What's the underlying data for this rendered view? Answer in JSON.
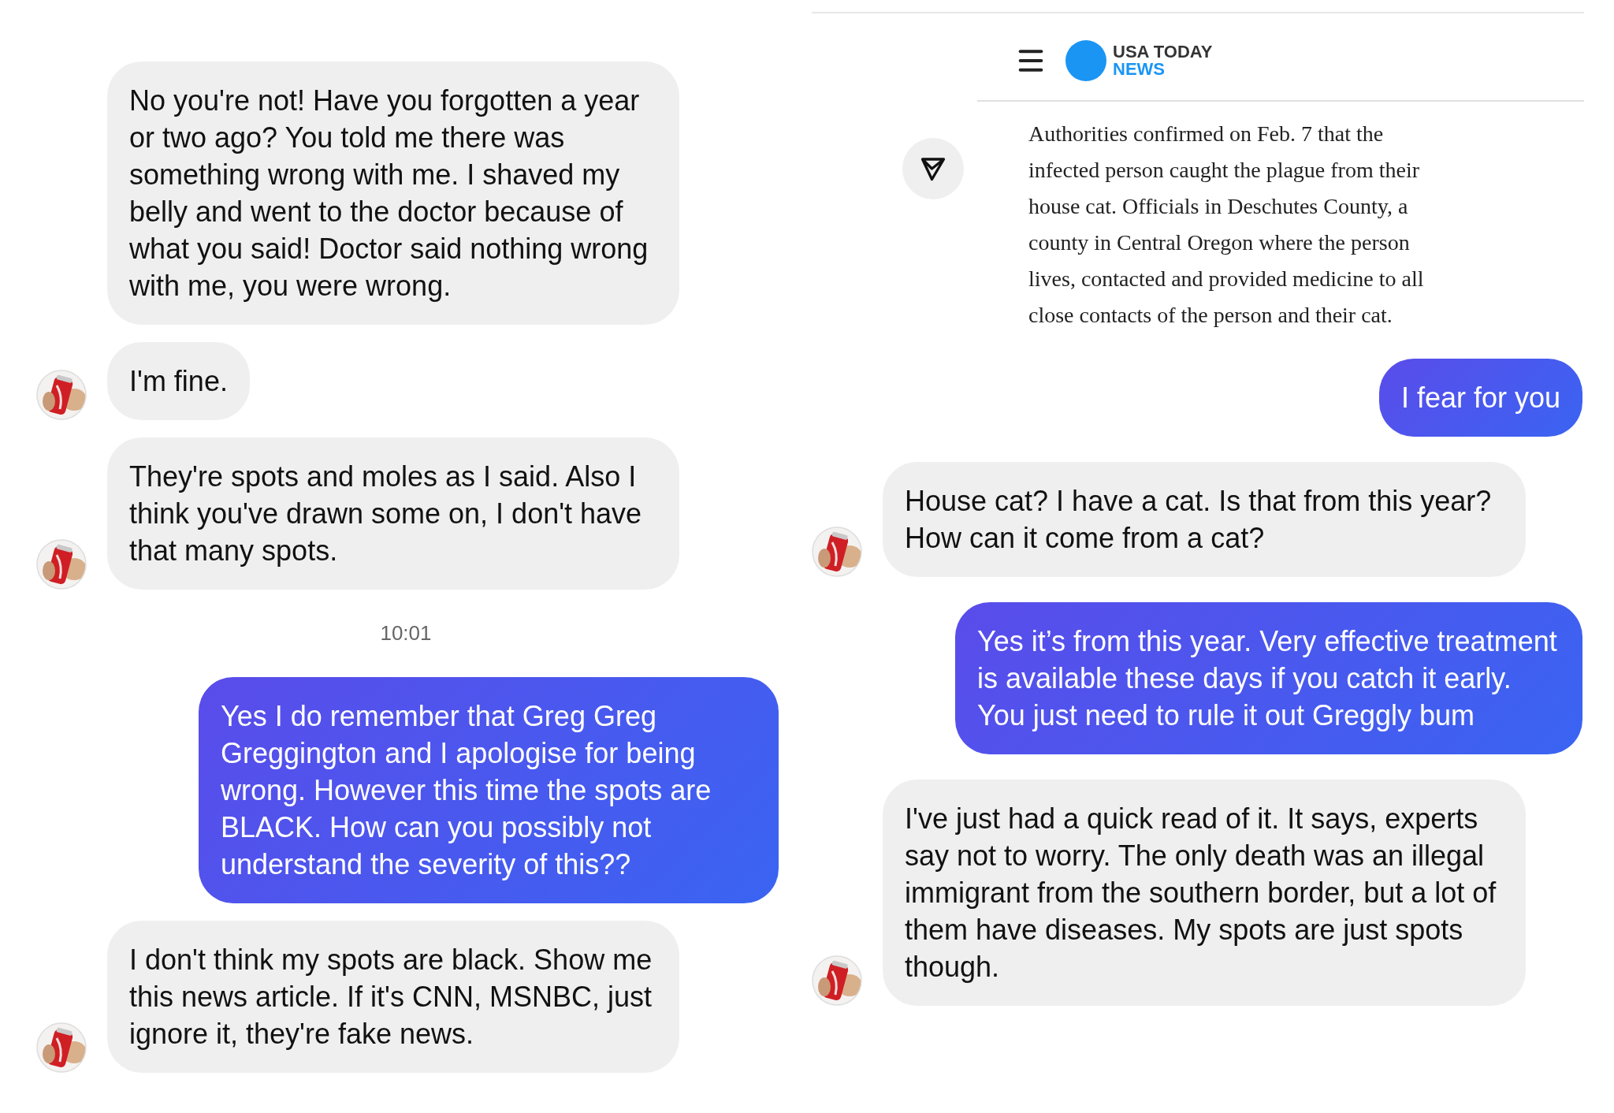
{
  "left_thread": [
    {
      "kind": "received",
      "avatar": false,
      "text": "No you're not! Have you forgotten a year or two ago? You told me there was something wrong with me. I shaved my belly and went to the doctor because of what you said! Doctor said nothing wrong with me, you were wrong."
    },
    {
      "kind": "received",
      "avatar": true,
      "text": "I'm fine."
    },
    {
      "kind": "received",
      "avatar": true,
      "text": "They're spots and moles as I said. Also I think you've drawn some on, I don't have that many spots."
    },
    {
      "kind": "time",
      "text": "10:01"
    },
    {
      "kind": "sent",
      "text": "Yes I do remember that Greg Greg Greggington and I apologise for being wrong. However this time the spots are BLACK. How can you possibly not understand the severity of this??"
    },
    {
      "kind": "received",
      "avatar": true,
      "text": "I don't think my spots are black. Show me this news article. If it's CNN, MSNBC, just ignore it, they're fake news."
    }
  ],
  "right_thread": [
    {
      "kind": "article",
      "logo_top": "USA TODAY",
      "logo_bottom": "NEWS",
      "text": "Authorities confirmed on Feb. 7 that the infected person caught the plague from their house cat. Officials in Deschutes County, a county in Central Oregon where the person lives, contacted and provided medicine to all close contacts of the person and their cat."
    },
    {
      "kind": "sent",
      "text": "I fear for you"
    },
    {
      "kind": "received",
      "avatar": true,
      "text": "House cat? I have a cat. Is that from this year? How can it come from a cat?"
    },
    {
      "kind": "sent",
      "text": "Yes it’s from this year. Very effective treatment is available these days if you catch it early. You just need to rule it out Greggly bum"
    },
    {
      "kind": "received",
      "avatar": true,
      "text": "I've just had a quick read of it. It says, experts say not to worry. The only death was an illegal immigrant from the southern border, but a lot of them have diseases. My spots are just spots though."
    }
  ]
}
